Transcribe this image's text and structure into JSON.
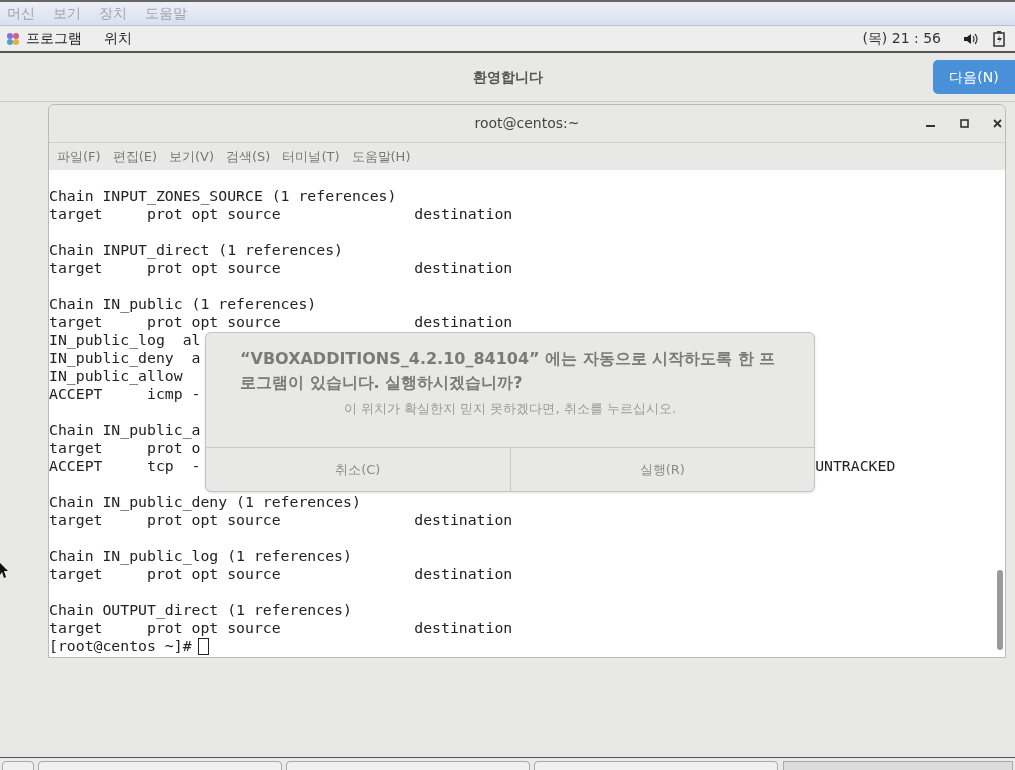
{
  "vm_menu": [
    "머신",
    "보기",
    "장치",
    "도움말"
  ],
  "top_bar": {
    "apps": "프로그램",
    "places": "위치",
    "clock": "(목) 21 : 56"
  },
  "header": {
    "title": "환영합니다",
    "next_button": "다음(N)"
  },
  "terminal": {
    "title": "root@centos:~",
    "menu": [
      "파일(F)",
      "편집(E)",
      "보기(V)",
      "검색(S)",
      "터미널(T)",
      "도움말(H)"
    ],
    "lines": [
      {
        "kind": "text",
        "text": "Chain INPUT_ZONES_SOURCE (1 references)"
      },
      {
        "kind": "text",
        "text": "target     prot opt source               destination"
      },
      {
        "kind": "blank"
      },
      {
        "kind": "text",
        "text": "Chain INPUT_direct (1 references)"
      },
      {
        "kind": "text",
        "text": "target     prot opt source               destination"
      },
      {
        "kind": "blank"
      },
      {
        "kind": "text",
        "text": "Chain IN_public (1 references)"
      },
      {
        "kind": "text",
        "text": "target     prot opt source               destination"
      },
      {
        "kind": "text",
        "text": "IN_public_log  al"
      },
      {
        "kind": "text",
        "text": "IN_public_deny  a"
      },
      {
        "kind": "text",
        "text": "IN_public_allow"
      },
      {
        "kind": "text",
        "text": "ACCEPT     icmp -"
      },
      {
        "kind": "blank"
      },
      {
        "kind": "text",
        "text": "Chain IN_public_a"
      },
      {
        "kind": "text",
        "text": "target     prot o"
      },
      {
        "kind": "text",
        "text": "ACCEPT     tcp  -",
        "right": "UNTRACKED"
      },
      {
        "kind": "blank"
      },
      {
        "kind": "text",
        "text": "Chain IN_public_deny (1 references)"
      },
      {
        "kind": "text",
        "text": "target     prot opt source               destination"
      },
      {
        "kind": "blank"
      },
      {
        "kind": "text",
        "text": "Chain IN_public_log (1 references)"
      },
      {
        "kind": "text",
        "text": "target     prot opt source               destination"
      },
      {
        "kind": "blank"
      },
      {
        "kind": "text",
        "text": "Chain OUTPUT_direct (1 references)"
      },
      {
        "kind": "text",
        "text": "target     prot opt source               destination"
      }
    ],
    "prompt": "[root@centos ~]#"
  },
  "dialog": {
    "message": "“VBOXADDITIONS_4.2.10_84104” 에는 자동으로 시작하도록 한 프로그램이 있습니다. 실행하시겠습니까?",
    "hint": "이 위치가 확실한지 믿지 못하겠다면, 취소를 누르십시오.",
    "buttons": [
      "취소(C)",
      "실행(R)"
    ]
  }
}
